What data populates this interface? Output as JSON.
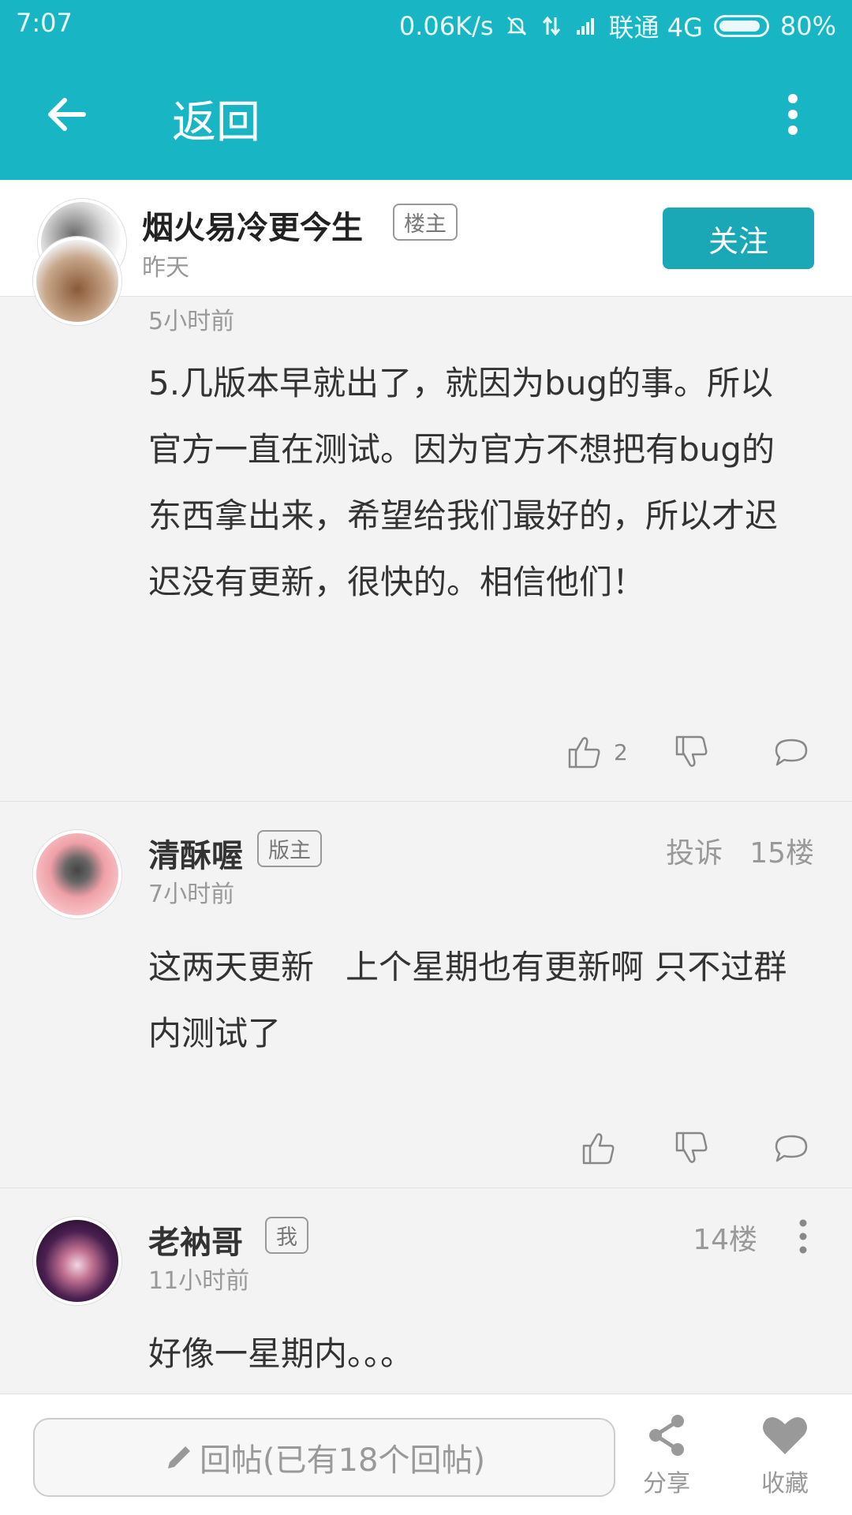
{
  "status_bar": {
    "time": "7:07",
    "speed": "0.06K/s",
    "carrier": "联通 4G",
    "battery": "80%"
  },
  "toolbar": {
    "back_label": "返回"
  },
  "author_card": {
    "name": "烟火易冷更今生",
    "badge": "楼主",
    "time": "昨天",
    "follow_label": "关注"
  },
  "posts": [
    {
      "time": "5小时前",
      "content": "5.几版本早就出了，就因为bug的事。所以官方一直在测试。因为官方不想把有bug的东西拿出来，希望给我们最好的，所以才迟迟没有更新，很快的。相信他们！",
      "like_count": "2"
    },
    {
      "name": "清酥喔",
      "badge": "版主",
      "time": "7小时前",
      "report": "投诉",
      "floor": "15楼",
      "content": "这两天更新   上个星期也有更新啊 只不过群内测试了"
    },
    {
      "name": "老衲哥",
      "badge": "我",
      "time": "11小时前",
      "floor": "14楼",
      "content": "好像一星期内。。。"
    }
  ],
  "bottom_bar": {
    "reply_placeholder": "回帖(已有18个回帖)",
    "share_label": "分享",
    "favorite_label": "收藏"
  },
  "colors": {
    "accent": "#18b5c5",
    "follow_button": "#1aa8b6"
  }
}
